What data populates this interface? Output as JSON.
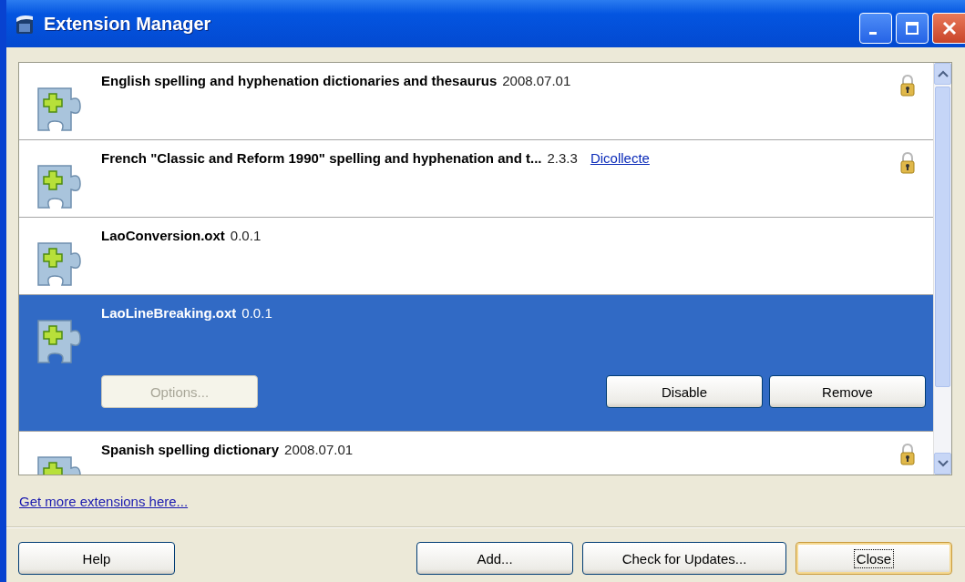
{
  "window": {
    "title": "Extension Manager"
  },
  "extensions": [
    {
      "name": "English spelling and hyphenation dictionaries and thesaurus",
      "version": "2008.07.01",
      "locked": true,
      "selected": false
    },
    {
      "name": "French \"Classic and Reform 1990\" spelling and hyphenation and t...",
      "version": "2.3.3",
      "link": "Dicollecte",
      "locked": true,
      "selected": false
    },
    {
      "name": "LaoConversion.oxt",
      "version": "0.0.1",
      "locked": false,
      "selected": false
    },
    {
      "name": "LaoLineBreaking.oxt",
      "version": "0.0.1",
      "locked": false,
      "selected": true,
      "actions": [
        {
          "label": "Options...",
          "disabled": true
        },
        {
          "label": "Disable",
          "disabled": false
        },
        {
          "label": "Remove",
          "disabled": false
        }
      ]
    },
    {
      "name": "Spanish spelling dictionary",
      "version": "2008.07.01",
      "locked": true,
      "selected": false
    }
  ],
  "more_link": "Get more extensions here...",
  "buttons": [
    {
      "label": "Help",
      "default": false
    },
    {
      "label": "Add...",
      "default": false
    },
    {
      "label": "Check for Updates...",
      "default": false
    },
    {
      "label": "Close",
      "default": true
    }
  ]
}
